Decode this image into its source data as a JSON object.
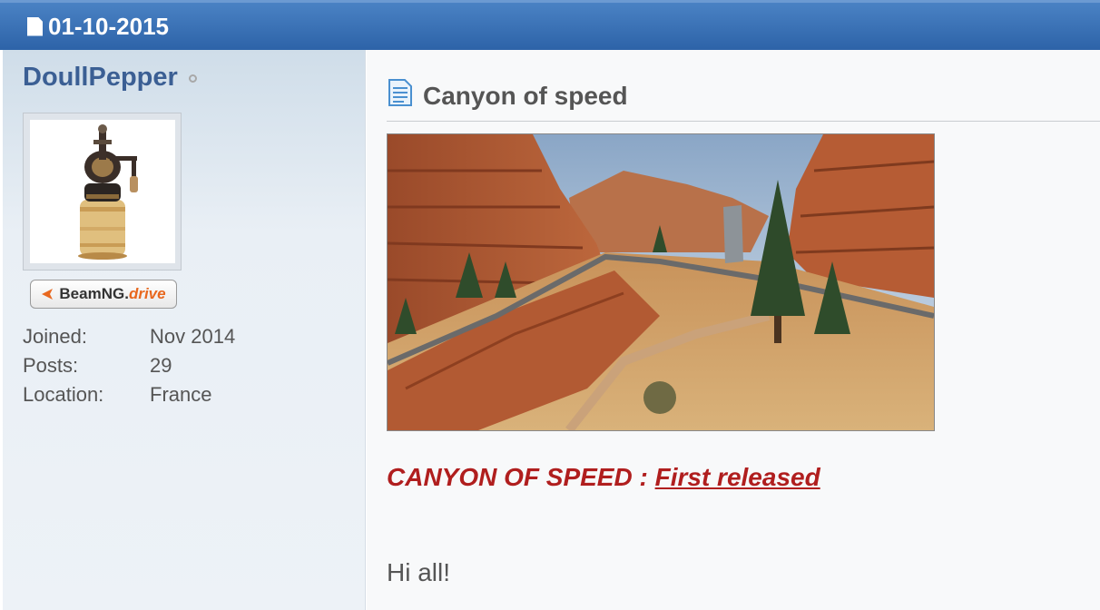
{
  "post": {
    "date": "01-10-2015",
    "title": "Canyon of speed",
    "release_prefix": "CANYON OF SPEED :",
    "release_link": "First released",
    "greeting": "Hi all!"
  },
  "author": {
    "name": "DoullPepper",
    "status": "offline",
    "badge": {
      "brand": "BeamNG.",
      "product": "drive"
    },
    "stats": [
      {
        "label": "Joined:",
        "value": "Nov 2014"
      },
      {
        "label": "Posts:",
        "value": "29"
      },
      {
        "label": "Location:",
        "value": "France"
      }
    ]
  },
  "colors": {
    "header": "#3a70b6",
    "username": "#3b5f94",
    "release": "#b01e1e",
    "badge_accent": "#e8681f"
  },
  "icons": {
    "header": "document-icon",
    "title": "text-document-icon",
    "online": "status-dot-icon"
  }
}
